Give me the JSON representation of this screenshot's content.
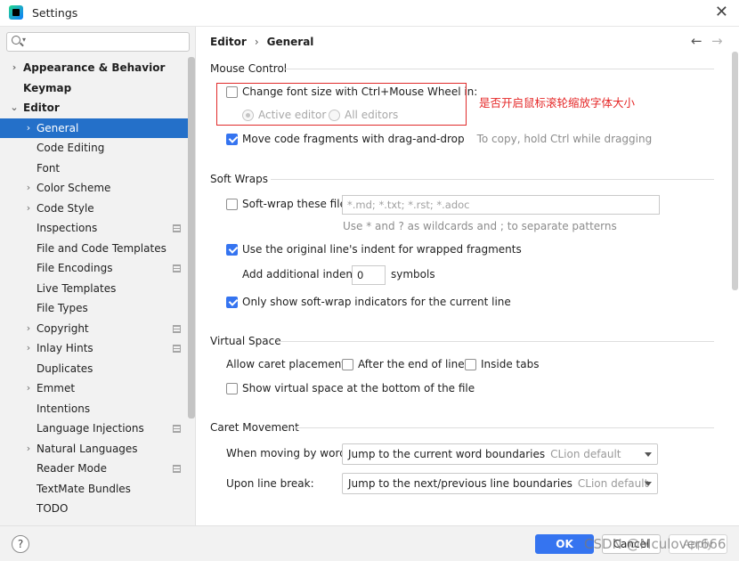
{
  "window": {
    "title": "Settings",
    "close_icon": "close-icon"
  },
  "sidebar": {
    "search_placeholder": "",
    "items": [
      {
        "label": "Appearance & Behavior",
        "level": 0,
        "arrow": true,
        "bold": true,
        "selected": false,
        "proj": false
      },
      {
        "label": "Keymap",
        "level": 0,
        "arrow": false,
        "bold": true,
        "selected": false,
        "proj": false
      },
      {
        "label": "Editor",
        "level": 0,
        "arrow": true,
        "expanded": true,
        "bold": true,
        "selected": false,
        "proj": false
      },
      {
        "label": "General",
        "level": 1,
        "arrow": true,
        "bold": false,
        "selected": true,
        "proj": false
      },
      {
        "label": "Code Editing",
        "level": 1,
        "arrow": false,
        "bold": false,
        "selected": false,
        "proj": false
      },
      {
        "label": "Font",
        "level": 1,
        "arrow": false,
        "bold": false,
        "selected": false,
        "proj": false
      },
      {
        "label": "Color Scheme",
        "level": 1,
        "arrow": true,
        "bold": false,
        "selected": false,
        "proj": false
      },
      {
        "label": "Code Style",
        "level": 1,
        "arrow": true,
        "bold": false,
        "selected": false,
        "proj": false
      },
      {
        "label": "Inspections",
        "level": 1,
        "arrow": false,
        "bold": false,
        "selected": false,
        "proj": true
      },
      {
        "label": "File and Code Templates",
        "level": 1,
        "arrow": false,
        "bold": false,
        "selected": false,
        "proj": false
      },
      {
        "label": "File Encodings",
        "level": 1,
        "arrow": false,
        "bold": false,
        "selected": false,
        "proj": true
      },
      {
        "label": "Live Templates",
        "level": 1,
        "arrow": false,
        "bold": false,
        "selected": false,
        "proj": false
      },
      {
        "label": "File Types",
        "level": 1,
        "arrow": false,
        "bold": false,
        "selected": false,
        "proj": false
      },
      {
        "label": "Copyright",
        "level": 1,
        "arrow": true,
        "bold": false,
        "selected": false,
        "proj": true
      },
      {
        "label": "Inlay Hints",
        "level": 1,
        "arrow": true,
        "bold": false,
        "selected": false,
        "proj": true
      },
      {
        "label": "Duplicates",
        "level": 1,
        "arrow": false,
        "bold": false,
        "selected": false,
        "proj": false
      },
      {
        "label": "Emmet",
        "level": 1,
        "arrow": true,
        "bold": false,
        "selected": false,
        "proj": false
      },
      {
        "label": "Intentions",
        "level": 1,
        "arrow": false,
        "bold": false,
        "selected": false,
        "proj": false
      },
      {
        "label": "Language Injections",
        "level": 1,
        "arrow": false,
        "bold": false,
        "selected": false,
        "proj": true
      },
      {
        "label": "Natural Languages",
        "level": 1,
        "arrow": true,
        "bold": false,
        "selected": false,
        "proj": false
      },
      {
        "label": "Reader Mode",
        "level": 1,
        "arrow": false,
        "bold": false,
        "selected": false,
        "proj": true
      },
      {
        "label": "TextMate Bundles",
        "level": 1,
        "arrow": false,
        "bold": false,
        "selected": false,
        "proj": false
      },
      {
        "label": "TODO",
        "level": 1,
        "arrow": false,
        "bold": false,
        "selected": false,
        "proj": false
      }
    ]
  },
  "header": {
    "crumb1": "Editor",
    "separator": "›",
    "crumb2": "General",
    "back": "←",
    "forward": "→"
  },
  "mouse_control": {
    "title": "Mouse Control",
    "font_size_wheel": {
      "label": "Change font size with Ctrl+Mouse Wheel in:",
      "checked": false
    },
    "active_editor": {
      "label": "Active editor",
      "checked": true
    },
    "all_editors": {
      "label": "All editors",
      "checked": false
    },
    "drag_drop": {
      "label": "Move code fragments with drag-and-drop",
      "checked": true,
      "hint": "To copy, hold Ctrl while dragging"
    },
    "annotation": "是否开启鼠标滚轮缩放字体大小"
  },
  "soft_wraps": {
    "title": "Soft Wraps",
    "wrap_files": {
      "label": "Soft-wrap these files:",
      "checked": false,
      "value": "*.md; *.txt; *.rst; *.adoc"
    },
    "patterns_hint": "Use * and ? as wildcards and ; to separate patterns",
    "original_indent": {
      "label": "Use the original line's indent for wrapped fragments",
      "checked": true
    },
    "additional_indent": {
      "label": "Add additional indent:",
      "value": "0",
      "suffix": "symbols"
    },
    "indicators": {
      "label": "Only show soft-wrap indicators for the current line",
      "checked": true
    }
  },
  "virtual_space": {
    "title": "Virtual Space",
    "caret_label": "Allow caret placement:",
    "after_end": {
      "label": "After the end of line",
      "checked": false
    },
    "inside_tabs": {
      "label": "Inside tabs",
      "checked": false
    },
    "bottom_file": {
      "label": "Show virtual space at the bottom of the file",
      "checked": false
    }
  },
  "caret_movement": {
    "title": "Caret Movement",
    "words_label": "When moving by words:",
    "words_value": "Jump to the current word boundaries",
    "words_default": "CLion default",
    "line_label": "Upon line break:",
    "line_value": "Jump to the next/previous line boundaries",
    "line_default": "CLion default"
  },
  "footer": {
    "help": "?",
    "ok": "OK",
    "cancel": "Cancel",
    "apply": "Apply",
    "watermark": "CSDN @Mculover666"
  },
  "colors": {
    "accent": "#3574f0",
    "selection": "#2470c9",
    "annotation": "#e02b2b"
  }
}
